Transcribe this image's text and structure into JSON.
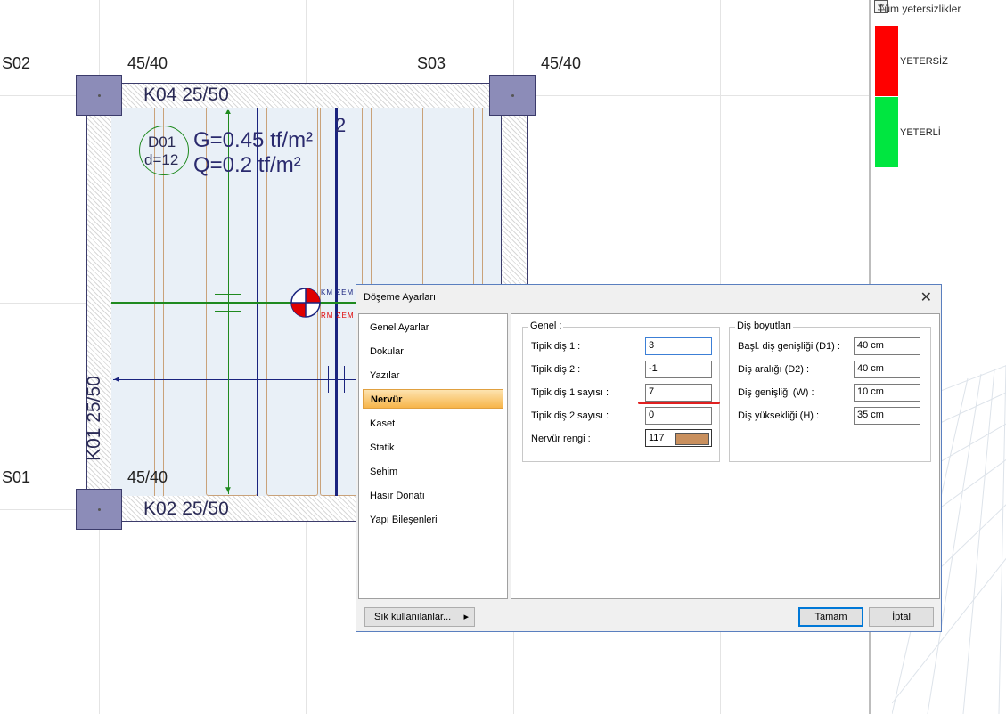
{
  "canvas": {
    "columns": {
      "s02": "S02",
      "s03": "S03",
      "s01": "S01",
      "dim_top_left": "45/40",
      "dim_top_right": "45/40",
      "dim_bottom_left": "45/40"
    },
    "beams": {
      "k04": "K04 25/50",
      "k02": "K02 25/50",
      "k01": "K01 25/50"
    },
    "slab": {
      "id": "D01",
      "thickness": "d=12",
      "load_g": "G=0.45 tf/m²",
      "load_q": "Q=0.2 tf/m²",
      "span_mark": "2",
      "symbol_label_1": "KM ZEM",
      "symbol_label_2": "RM ZEM"
    },
    "colors": {
      "rib": "#c9a27a",
      "axis_green": "#1f8a1f",
      "axis_blue": "#1a237e",
      "slab_fill": "#e9f0f7"
    }
  },
  "legend": {
    "title": "Tüm yetersizlikler",
    "toggle_icon": "triangle-up-icon",
    "items": [
      {
        "label": "YETERSİZ",
        "color": "#ff0000"
      },
      {
        "label": "YETERLİ",
        "color": "#00e640"
      }
    ]
  },
  "dialog": {
    "title": "Döşeme Ayarları",
    "close_glyph": "✕",
    "nav": [
      {
        "label": "Genel Ayarlar",
        "active": false
      },
      {
        "label": "Dokular",
        "active": false
      },
      {
        "label": "Yazılar",
        "active": false
      },
      {
        "label": "Nervür",
        "active": true
      },
      {
        "label": "Kaset",
        "active": false
      },
      {
        "label": "Statik",
        "active": false
      },
      {
        "label": "Sehim",
        "active": false
      },
      {
        "label": "Hasır Donatı",
        "active": false
      },
      {
        "label": "Yapı Bileşenleri",
        "active": false
      }
    ],
    "genel": {
      "title": "Genel :",
      "fields": [
        {
          "label": "Tipik diş 1 :",
          "value": "3"
        },
        {
          "label": "Tipik diş 2 :",
          "value": "-1"
        },
        {
          "label": "Tipik diş 1 sayısı :",
          "value": "7"
        },
        {
          "label": "Tipik diş 2 sayısı :",
          "value": "0"
        }
      ],
      "rib_color_label": "Nervür rengi :",
      "rib_color_value": "117",
      "rib_color_swatch": "#c9905e"
    },
    "dis": {
      "title": "Diş boyutları",
      "fields": [
        {
          "label": "Başl. diş genişliği (D1) :",
          "value": "40 cm"
        },
        {
          "label": "Diş aralığı (D2) :",
          "value": "40 cm"
        },
        {
          "label": "Diş genişliği (W) :",
          "value": "10 cm"
        },
        {
          "label": "Diş yüksekliği (H) :",
          "value": "35 cm"
        }
      ]
    },
    "footer": {
      "favorites": "Sık kullanılanlar...",
      "favorites_arrow": "▸",
      "ok": "Tamam",
      "cancel": "İptal"
    },
    "annotation_color": "#e02020"
  }
}
